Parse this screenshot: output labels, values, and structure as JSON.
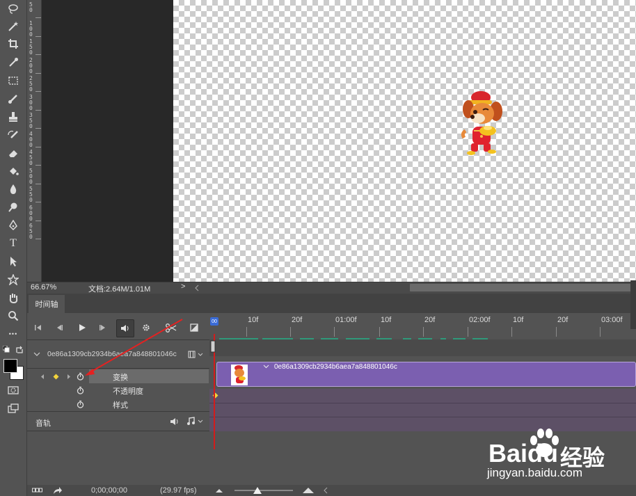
{
  "toolbar": {
    "tools": [
      "lasso-icon",
      "magic-wand-icon",
      "crop-icon",
      "eyedropper-icon",
      "marquee-icon",
      "brush-icon",
      "stamp-icon",
      "history-brush-icon",
      "eraser-icon",
      "paint-bucket-icon",
      "blur-icon",
      "dodge-icon",
      "pen-icon",
      "type-icon",
      "path-select-icon",
      "shape-icon",
      "hand-icon",
      "zoom-icon",
      "more-icon"
    ],
    "type_glyph": "T",
    "more_glyph": "•••"
  },
  "ruler": {
    "labels": [
      "5\n0",
      "1\n0\n0",
      "1\n5\n0",
      "2\n0\n0",
      "2\n5\n0",
      "3\n0\n0",
      "3\n5\n0",
      "4\n0\n0",
      "4\n5\n0",
      "5\n0\n0",
      "5\n5\n0",
      "6\n0\n0",
      "6\n5\n0"
    ]
  },
  "status": {
    "zoom": "66.67%",
    "doc": "文档:2.64M/1.01M",
    "arrow": ">"
  },
  "timeline": {
    "tab_label": "时间轴",
    "layer_name": "0e86a1309cb2934b6aea7a848801046c",
    "clip_name": "0e86a1309cb2934b6aea7a848801046c",
    "properties": [
      "变换",
      "不透明度",
      "样式"
    ],
    "audio_label": "音轨",
    "ruler_marks": [
      "10f",
      "20f",
      "01:00f",
      "10f",
      "20f",
      "02:00f",
      "10f",
      "20f",
      "03:00f"
    ],
    "playhead_label": "00",
    "timecode": "0;00;00;00",
    "fps": "(29.97 fps)"
  },
  "watermark": {
    "brand": "Baidu",
    "suffix": "经验",
    "url": "jingyan.baidu.com"
  },
  "colors": {
    "accent_purple": "#7b5fb0",
    "playhead_red": "#d21c1c",
    "keyframe_yellow": "#f2d33c"
  }
}
